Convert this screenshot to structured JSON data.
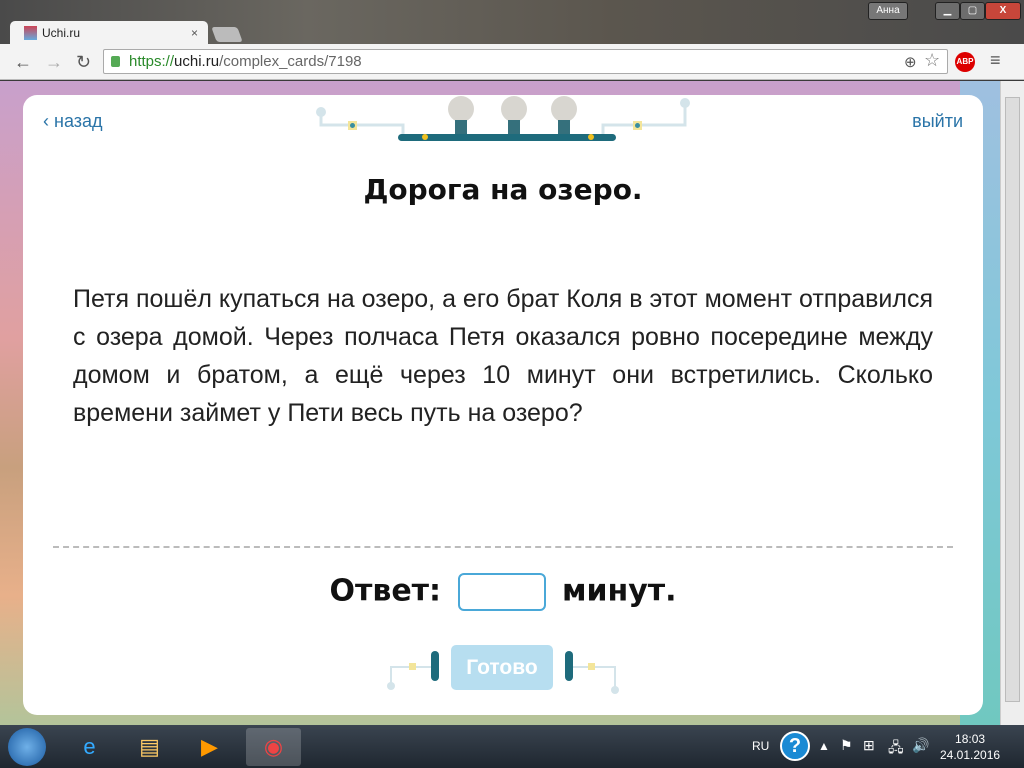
{
  "browser": {
    "user": "Анна",
    "tab_title": "Uchi.ru",
    "url_scheme": "https://",
    "url_host": "uchi.ru",
    "url_path": "/complex_cards/7198"
  },
  "card": {
    "back": "назад",
    "exit": "выйти",
    "title": "Дорога на озеро.",
    "problem": "Петя пошёл купаться на озеро, а его брат Коля в этот момент отправился с озера домой. Через полчаса Петя оказался ровно посередине между домом и братом, а ещё через 10 минут они встретились. Сколько времени займет у Пети весь путь на озеро?",
    "answer_label": "Ответ:",
    "answer_value": "",
    "answer_unit": "минут.",
    "submit": "Готово"
  },
  "taskbar": {
    "lang": "RU",
    "time": "18:03",
    "date": "24.01.2016"
  },
  "colors": {
    "link": "#2a74a8",
    "submit_disabled": "#b7def0",
    "input_border": "#4aa8d8"
  }
}
